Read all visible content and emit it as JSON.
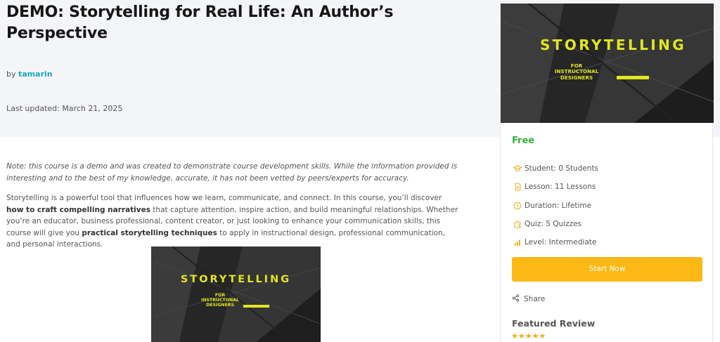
{
  "course": {
    "title": "DEMO: Storytelling for Real Life: An Author’s Perspective",
    "by_label": "by",
    "author": "tamarin",
    "last_updated": "Last updated: March 21, 2025"
  },
  "body": {
    "note": "Note: this course is a demo and was created to demonstrate course development skills. While the information provided is interesting and to the best of my knowledge, accurate, it has not been vetted by peers/experts for accuracy.",
    "desc_1": "Storytelling is a powerful tool that influences how we learn, communicate, and connect. In this course, you’ll discover ",
    "desc_bold_1": "how to craft compelling narratives",
    "desc_2": " that capture attention, inspire action, and build meaningful relationships. Whether you’re an educator, business professional, content creator, or just looking to enhance your communication skills, this course will give you ",
    "desc_bold_2": "practical storytelling techniques",
    "desc_3": " to apply in instructional design, professional communication, and personal interactions."
  },
  "banner": {
    "title": "STORYTELLING",
    "subtitle_1": "FOR",
    "subtitle_2": "INSTRUCTONAL",
    "subtitle_3": "DESIGNERS",
    "accent": "#e3e61e"
  },
  "sidebar": {
    "price": "Free",
    "meta": [
      {
        "icon": "graduation-cap-icon",
        "label": "Student: 0 Students"
      },
      {
        "icon": "document-icon",
        "label": "Lesson: 11 Lessons"
      },
      {
        "icon": "clock-icon",
        "label": "Duration: Lifetime"
      },
      {
        "icon": "puzzle-icon",
        "label": "Quiz: 5 Quizzes"
      },
      {
        "icon": "bar-chart-icon",
        "label": "Level: Intermediate"
      }
    ],
    "start_button": "Start Now",
    "share": "Share",
    "featured_review": "Featured Review",
    "rating_stars": "★★★★★"
  },
  "colors": {
    "accent_button": "#fcb814",
    "price": "#35b33c",
    "author_link": "#17a8c4",
    "icon": "#f2a91b",
    "hero_bg": "#f4f5f9"
  }
}
